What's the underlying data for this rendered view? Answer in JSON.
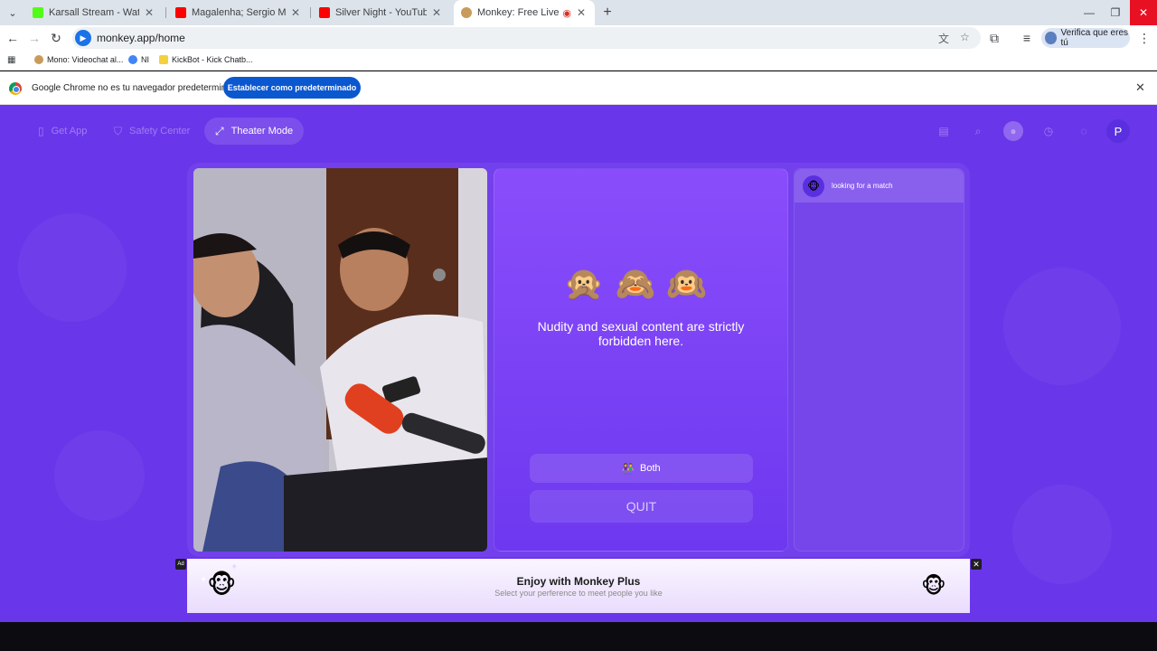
{
  "browser": {
    "tabs": [
      {
        "title": "Karsall Stream - Watch Live on",
        "favicon_color": "#53fc18"
      },
      {
        "title": "Magalenha; Sergio Mendes [Le",
        "favicon_color": "#ff0000"
      },
      {
        "title": "Silver Night - YouTube",
        "favicon_color": "#ff0000"
      },
      {
        "title": "Monkey: Free Live Video Ch",
        "favicon_color": "#c89b5a"
      }
    ],
    "url": "monkey.app/home",
    "profile_label": "Verifica que eres tú",
    "bookmarks": [
      {
        "label": "Mono: Videochat al...",
        "color": "#c89b5a"
      },
      {
        "label": "NI",
        "color": "#4285f4"
      },
      {
        "label": "KickBot - Kick Chatb...",
        "color": "#f4d03f"
      }
    ]
  },
  "infobar": {
    "message": "Google Chrome no es tu navegador predeterminado",
    "button": "Establecer como predeterminado"
  },
  "site": {
    "nav": {
      "get_app": "Get App",
      "safety_center": "Safety Center",
      "theater_mode": "Theater Mode"
    },
    "avatar_initial": "P",
    "match": {
      "emojis": "🙊🙈🙉",
      "notice": "Nudity and sexual content are strictly forbidden here.",
      "gender_filter": "Both",
      "gender_icon": "👫",
      "quit": "QUIT"
    },
    "chat": {
      "status": "looking for a match",
      "avatar_emoji": "🐵"
    },
    "ad": {
      "tag": "Ad",
      "title": "Enjoy with Monkey Plus",
      "subtitle": "Select your perference to meet people you like",
      "mascot": "🐵"
    }
  }
}
